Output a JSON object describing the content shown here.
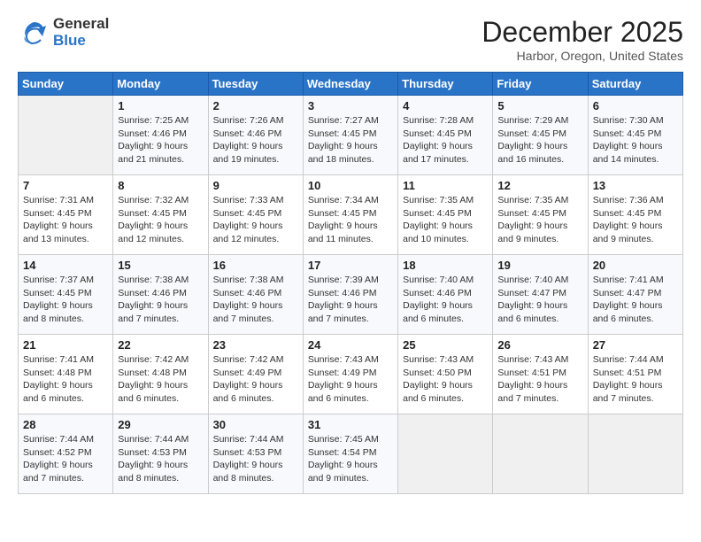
{
  "logo": {
    "general": "General",
    "blue": "Blue"
  },
  "title": "December 2025",
  "subtitle": "Harbor, Oregon, United States",
  "days_of_week": [
    "Sunday",
    "Monday",
    "Tuesday",
    "Wednesday",
    "Thursday",
    "Friday",
    "Saturday"
  ],
  "weeks": [
    [
      {
        "day": "",
        "info": ""
      },
      {
        "day": "1",
        "info": "Sunrise: 7:25 AM\nSunset: 4:46 PM\nDaylight: 9 hours\nand 21 minutes."
      },
      {
        "day": "2",
        "info": "Sunrise: 7:26 AM\nSunset: 4:46 PM\nDaylight: 9 hours\nand 19 minutes."
      },
      {
        "day": "3",
        "info": "Sunrise: 7:27 AM\nSunset: 4:45 PM\nDaylight: 9 hours\nand 18 minutes."
      },
      {
        "day": "4",
        "info": "Sunrise: 7:28 AM\nSunset: 4:45 PM\nDaylight: 9 hours\nand 17 minutes."
      },
      {
        "day": "5",
        "info": "Sunrise: 7:29 AM\nSunset: 4:45 PM\nDaylight: 9 hours\nand 16 minutes."
      },
      {
        "day": "6",
        "info": "Sunrise: 7:30 AM\nSunset: 4:45 PM\nDaylight: 9 hours\nand 14 minutes."
      }
    ],
    [
      {
        "day": "7",
        "info": "Sunrise: 7:31 AM\nSunset: 4:45 PM\nDaylight: 9 hours\nand 13 minutes."
      },
      {
        "day": "8",
        "info": "Sunrise: 7:32 AM\nSunset: 4:45 PM\nDaylight: 9 hours\nand 12 minutes."
      },
      {
        "day": "9",
        "info": "Sunrise: 7:33 AM\nSunset: 4:45 PM\nDaylight: 9 hours\nand 12 minutes."
      },
      {
        "day": "10",
        "info": "Sunrise: 7:34 AM\nSunset: 4:45 PM\nDaylight: 9 hours\nand 11 minutes."
      },
      {
        "day": "11",
        "info": "Sunrise: 7:35 AM\nSunset: 4:45 PM\nDaylight: 9 hours\nand 10 minutes."
      },
      {
        "day": "12",
        "info": "Sunrise: 7:35 AM\nSunset: 4:45 PM\nDaylight: 9 hours\nand 9 minutes."
      },
      {
        "day": "13",
        "info": "Sunrise: 7:36 AM\nSunset: 4:45 PM\nDaylight: 9 hours\nand 9 minutes."
      }
    ],
    [
      {
        "day": "14",
        "info": "Sunrise: 7:37 AM\nSunset: 4:45 PM\nDaylight: 9 hours\nand 8 minutes."
      },
      {
        "day": "15",
        "info": "Sunrise: 7:38 AM\nSunset: 4:46 PM\nDaylight: 9 hours\nand 7 minutes."
      },
      {
        "day": "16",
        "info": "Sunrise: 7:38 AM\nSunset: 4:46 PM\nDaylight: 9 hours\nand 7 minutes."
      },
      {
        "day": "17",
        "info": "Sunrise: 7:39 AM\nSunset: 4:46 PM\nDaylight: 9 hours\nand 7 minutes."
      },
      {
        "day": "18",
        "info": "Sunrise: 7:40 AM\nSunset: 4:46 PM\nDaylight: 9 hours\nand 6 minutes."
      },
      {
        "day": "19",
        "info": "Sunrise: 7:40 AM\nSunset: 4:47 PM\nDaylight: 9 hours\nand 6 minutes."
      },
      {
        "day": "20",
        "info": "Sunrise: 7:41 AM\nSunset: 4:47 PM\nDaylight: 9 hours\nand 6 minutes."
      }
    ],
    [
      {
        "day": "21",
        "info": "Sunrise: 7:41 AM\nSunset: 4:48 PM\nDaylight: 9 hours\nand 6 minutes."
      },
      {
        "day": "22",
        "info": "Sunrise: 7:42 AM\nSunset: 4:48 PM\nDaylight: 9 hours\nand 6 minutes."
      },
      {
        "day": "23",
        "info": "Sunrise: 7:42 AM\nSunset: 4:49 PM\nDaylight: 9 hours\nand 6 minutes."
      },
      {
        "day": "24",
        "info": "Sunrise: 7:43 AM\nSunset: 4:49 PM\nDaylight: 9 hours\nand 6 minutes."
      },
      {
        "day": "25",
        "info": "Sunrise: 7:43 AM\nSunset: 4:50 PM\nDaylight: 9 hours\nand 6 minutes."
      },
      {
        "day": "26",
        "info": "Sunrise: 7:43 AM\nSunset: 4:51 PM\nDaylight: 9 hours\nand 7 minutes."
      },
      {
        "day": "27",
        "info": "Sunrise: 7:44 AM\nSunset: 4:51 PM\nDaylight: 9 hours\nand 7 minutes."
      }
    ],
    [
      {
        "day": "28",
        "info": "Sunrise: 7:44 AM\nSunset: 4:52 PM\nDaylight: 9 hours\nand 7 minutes."
      },
      {
        "day": "29",
        "info": "Sunrise: 7:44 AM\nSunset: 4:53 PM\nDaylight: 9 hours\nand 8 minutes."
      },
      {
        "day": "30",
        "info": "Sunrise: 7:44 AM\nSunset: 4:53 PM\nDaylight: 9 hours\nand 8 minutes."
      },
      {
        "day": "31",
        "info": "Sunrise: 7:45 AM\nSunset: 4:54 PM\nDaylight: 9 hours\nand 9 minutes."
      },
      {
        "day": "",
        "info": ""
      },
      {
        "day": "",
        "info": ""
      },
      {
        "day": "",
        "info": ""
      }
    ]
  ]
}
